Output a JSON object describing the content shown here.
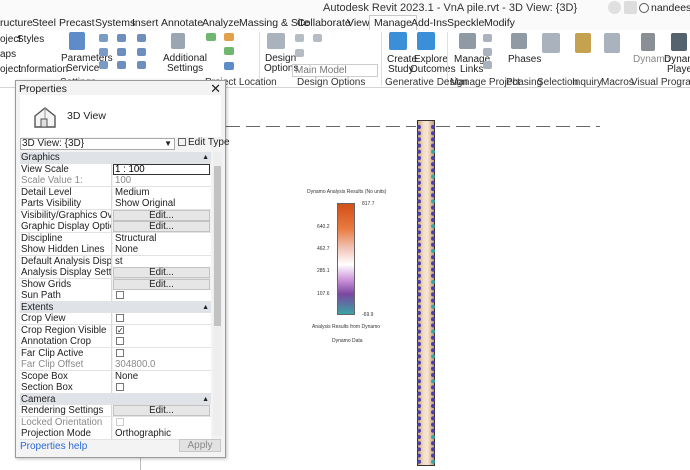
{
  "app": {
    "title": "Autodesk Revit 2023.1 - VnA pile.rvt - 3D View: {3D}",
    "user": "nandeesh.ba"
  },
  "tabs": [
    {
      "label": "ructure"
    },
    {
      "label": "Steel"
    },
    {
      "label": "Precast"
    },
    {
      "label": "Systems"
    },
    {
      "label": "Insert"
    },
    {
      "label": "Annotate"
    },
    {
      "label": "Analyze"
    },
    {
      "label": "Massing & Site"
    },
    {
      "label": "Collaborate"
    },
    {
      "label": "View"
    },
    {
      "label": "Manage"
    },
    {
      "label": "Add-Ins"
    },
    {
      "label": "Speckle"
    },
    {
      "label": "Modify"
    }
  ],
  "ribbon": {
    "left_items": [
      "oject",
      "Styles",
      "aps",
      "oject",
      "Information"
    ],
    "parameters_service": "Parameters",
    "parameters_service2": "Service",
    "additional_settings": "Additional",
    "additional_settings2": "Settings",
    "settings_group": "Settings",
    "project_location_group": "Project Location",
    "design_options": "Design",
    "design_options2": "Options",
    "main_model": "Main Model",
    "design_options_group": "Design Options",
    "create_study": "Create",
    "create_study2": "Study",
    "explore_outcomes": "Explore",
    "explore_outcomes2": "Outcomes",
    "generative_design_group": "Generative Design",
    "manage_links": "Manage",
    "manage_links2": "Links",
    "manage_project_group": "Manage Project",
    "phases": "Phases",
    "phasing_group": "Phasing",
    "selection_group": "Selection",
    "inquiry_group": "Inquiry",
    "macros_group": "Macros",
    "dynamo": "Dynamo",
    "dynamo_player": "Dynamo",
    "dynamo_player2": "Player",
    "visual_programming_group": "Visual Programming"
  },
  "properties": {
    "title": "Properties",
    "close": "✕",
    "type_name": "3D View",
    "selector": "3D View: {3D}",
    "edit_type": "Edit Type",
    "help": "Properties help",
    "apply": "Apply",
    "rows": [
      {
        "kind": "cat",
        "name": "Graphics"
      },
      {
        "kind": "input",
        "name": "View Scale",
        "value": "1 : 100"
      },
      {
        "kind": "text",
        "name": "Scale Value    1:",
        "value": "100",
        "dim": true
      },
      {
        "kind": "text",
        "name": "Detail Level",
        "value": "Medium"
      },
      {
        "kind": "text",
        "name": "Parts Visibility",
        "value": "Show Original"
      },
      {
        "kind": "button",
        "name": "Visibility/Graphics Overrid...",
        "value": "Edit..."
      },
      {
        "kind": "button",
        "name": "Graphic Display Options",
        "value": "Edit..."
      },
      {
        "kind": "text",
        "name": "Discipline",
        "value": "Structural"
      },
      {
        "kind": "text",
        "name": "Show Hidden Lines",
        "value": "None"
      },
      {
        "kind": "text",
        "name": "Default Analysis Display S...",
        "value": "st"
      },
      {
        "kind": "button",
        "name": "Analysis Display Settings",
        "value": "Edit..."
      },
      {
        "kind": "button",
        "name": "Show Grids",
        "value": "Edit..."
      },
      {
        "kind": "check",
        "name": "Sun Path",
        "checked": false
      },
      {
        "kind": "cat",
        "name": "Extents"
      },
      {
        "kind": "check",
        "name": "Crop View",
        "checked": false
      },
      {
        "kind": "check",
        "name": "Crop Region Visible",
        "checked": true
      },
      {
        "kind": "check",
        "name": "Annotation Crop",
        "checked": false
      },
      {
        "kind": "check",
        "name": "Far Clip Active",
        "checked": false
      },
      {
        "kind": "text",
        "name": "Far Clip Offset",
        "value": "304800.0",
        "dim": true
      },
      {
        "kind": "text",
        "name": "Scope Box",
        "value": "None"
      },
      {
        "kind": "check",
        "name": "Section Box",
        "checked": false
      },
      {
        "kind": "cat",
        "name": "Camera"
      },
      {
        "kind": "button",
        "name": "Rendering Settings",
        "value": "Edit..."
      },
      {
        "kind": "check",
        "name": "Locked Orientation",
        "checked": false,
        "dim": true
      },
      {
        "kind": "text",
        "name": "Projection Mode",
        "value": "Orthographic"
      }
    ]
  },
  "legend": {
    "title": "Dynamo Analysis Results (No units)",
    "ticks": [
      "817.7",
      "640.2",
      "462.7",
      "285.1",
      "107.6",
      "-69.9"
    ],
    "subtitle": "Analysis Results from Dynamo",
    "caption": "Dynamo Data"
  },
  "colors": {
    "accent": "#2a6ad6",
    "legend_top": "#d24f1a",
    "legend_bottom": "#3aa4a4",
    "pile_marker_main": "#4b3fa8",
    "pile_marker_alt": "#3aa4a4"
  }
}
